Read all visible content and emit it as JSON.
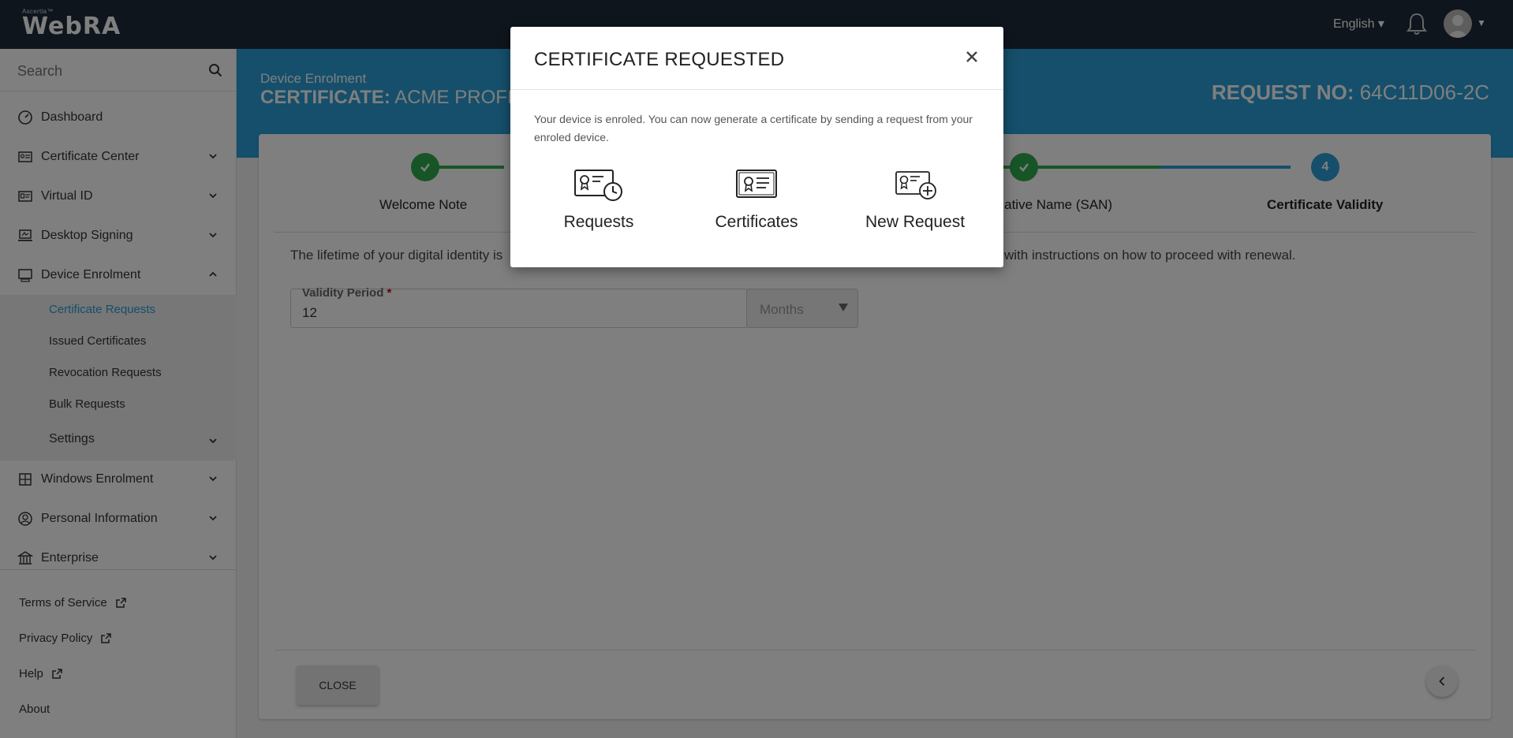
{
  "topbar": {
    "brand_small": "Ascertia™",
    "brand": "WebRA",
    "language": "English ▾"
  },
  "sidebar": {
    "search_placeholder": "Search",
    "items": [
      {
        "label": "Dashboard"
      },
      {
        "label": "Certificate Center"
      },
      {
        "label": "Virtual ID"
      },
      {
        "label": "Desktop Signing"
      },
      {
        "label": "Device Enrolment"
      },
      {
        "label": "Windows Enrolment"
      },
      {
        "label": "Personal Information"
      },
      {
        "label": "Enterprise"
      }
    ],
    "sub_items": [
      {
        "label": "Certificate Requests"
      },
      {
        "label": "Issued Certificates"
      },
      {
        "label": "Revocation Requests"
      },
      {
        "label": "Bulk Requests"
      },
      {
        "label": "Settings"
      }
    ],
    "footer": [
      {
        "label": "Terms of Service"
      },
      {
        "label": "Privacy Policy"
      },
      {
        "label": "Help"
      },
      {
        "label": "About"
      }
    ]
  },
  "banner": {
    "subtitle": "Device Enrolment",
    "title_prefix": "CERTIFICATE:",
    "title_value": "ACME PROFILE",
    "request_prefix": "REQUEST NO:",
    "request_value": "64C11D06-2C"
  },
  "steps": [
    {
      "label": "Welcome Note",
      "state": "done"
    },
    {
      "label": "rnative Name (SAN)",
      "state": "done"
    },
    {
      "label": "Certificate Validity",
      "state": "current",
      "number": "4"
    }
  ],
  "form": {
    "lifetime_text": "The lifetime of your digital identity is",
    "lifetime_tail": "with instructions on how to proceed with renewal.",
    "validity_label": "Validity Period",
    "required_mark": "*",
    "validity_value": "12",
    "unit": "Months",
    "close_label": "CLOSE"
  },
  "modal": {
    "title": "CERTIFICATE REQUESTED",
    "message": "Your device is enroled. You can now generate a certificate by sending a request from your enroled device.",
    "options": [
      {
        "label": "Requests",
        "icon": "certificate-clock-icon"
      },
      {
        "label": "Certificates",
        "icon": "certificate-icon"
      },
      {
        "label": "New Request",
        "icon": "certificate-add-icon"
      }
    ]
  },
  "colors": {
    "topbar": "#1c2a38",
    "accent": "#2a9fd6",
    "success": "#2eaa4f"
  }
}
